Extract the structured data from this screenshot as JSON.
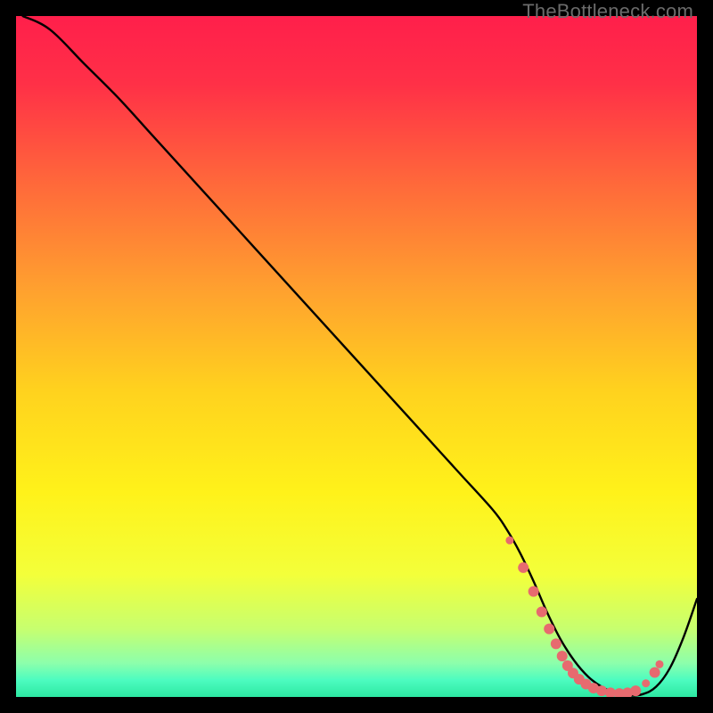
{
  "watermark": "TheBottleneck.com",
  "chart_data": {
    "type": "line",
    "title": "",
    "xlabel": "",
    "ylabel": "",
    "xlim": [
      0,
      100
    ],
    "ylim": [
      0,
      100
    ],
    "grid": false,
    "legend": false,
    "background_gradient": {
      "stops": [
        {
          "offset": 0.0,
          "color": "#ff1f4b"
        },
        {
          "offset": 0.1,
          "color": "#ff3047"
        },
        {
          "offset": 0.25,
          "color": "#ff6a3a"
        },
        {
          "offset": 0.4,
          "color": "#ffa02f"
        },
        {
          "offset": 0.55,
          "color": "#ffd21e"
        },
        {
          "offset": 0.7,
          "color": "#fff21a"
        },
        {
          "offset": 0.82,
          "color": "#f3ff3a"
        },
        {
          "offset": 0.9,
          "color": "#c7ff6f"
        },
        {
          "offset": 0.95,
          "color": "#8dffab"
        },
        {
          "offset": 0.975,
          "color": "#4dfcc0"
        },
        {
          "offset": 1.0,
          "color": "#2de8a2"
        }
      ]
    },
    "series": [
      {
        "name": "bottleneck-curve",
        "color": "#000000",
        "x": [
          1,
          5,
          10,
          15,
          20,
          25,
          30,
          35,
          40,
          45,
          50,
          55,
          60,
          65,
          70,
          72,
          74,
          76,
          78,
          80,
          82,
          84,
          86,
          88,
          90,
          92,
          94,
          96,
          98,
          100
        ],
        "y": [
          100,
          98,
          93,
          88,
          82.5,
          77,
          71.5,
          66,
          60.5,
          55,
          49.5,
          44,
          38.5,
          33,
          27.5,
          24.7,
          21.2,
          17,
          12.4,
          8.4,
          5.3,
          3.0,
          1.5,
          0.6,
          0.2,
          0.4,
          1.5,
          4.2,
          8.7,
          14.4
        ]
      }
    ],
    "markers": {
      "name": "highlight-dots",
      "color": "#e76a6f",
      "radius_small": 4.5,
      "radius_large": 6.0,
      "points": [
        {
          "x": 72.5,
          "y": 23.0,
          "r": "small"
        },
        {
          "x": 74.5,
          "y": 19.0,
          "r": "large"
        },
        {
          "x": 76.0,
          "y": 15.5,
          "r": "large"
        },
        {
          "x": 77.2,
          "y": 12.5,
          "r": "large"
        },
        {
          "x": 78.3,
          "y": 10.0,
          "r": "large"
        },
        {
          "x": 79.3,
          "y": 7.8,
          "r": "large"
        },
        {
          "x": 80.2,
          "y": 6.0,
          "r": "large"
        },
        {
          "x": 81.0,
          "y": 4.6,
          "r": "large"
        },
        {
          "x": 81.8,
          "y": 3.5,
          "r": "large"
        },
        {
          "x": 82.7,
          "y": 2.6,
          "r": "large"
        },
        {
          "x": 83.7,
          "y": 1.9,
          "r": "large"
        },
        {
          "x": 84.8,
          "y": 1.3,
          "r": "large"
        },
        {
          "x": 86.0,
          "y": 0.9,
          "r": "large"
        },
        {
          "x": 87.3,
          "y": 0.6,
          "r": "large"
        },
        {
          "x": 88.6,
          "y": 0.5,
          "r": "large"
        },
        {
          "x": 89.8,
          "y": 0.6,
          "r": "large"
        },
        {
          "x": 91.0,
          "y": 0.9,
          "r": "large"
        },
        {
          "x": 92.5,
          "y": 2.0,
          "r": "small"
        },
        {
          "x": 93.8,
          "y": 3.6,
          "r": "large"
        },
        {
          "x": 94.5,
          "y": 4.8,
          "r": "small"
        }
      ]
    }
  }
}
